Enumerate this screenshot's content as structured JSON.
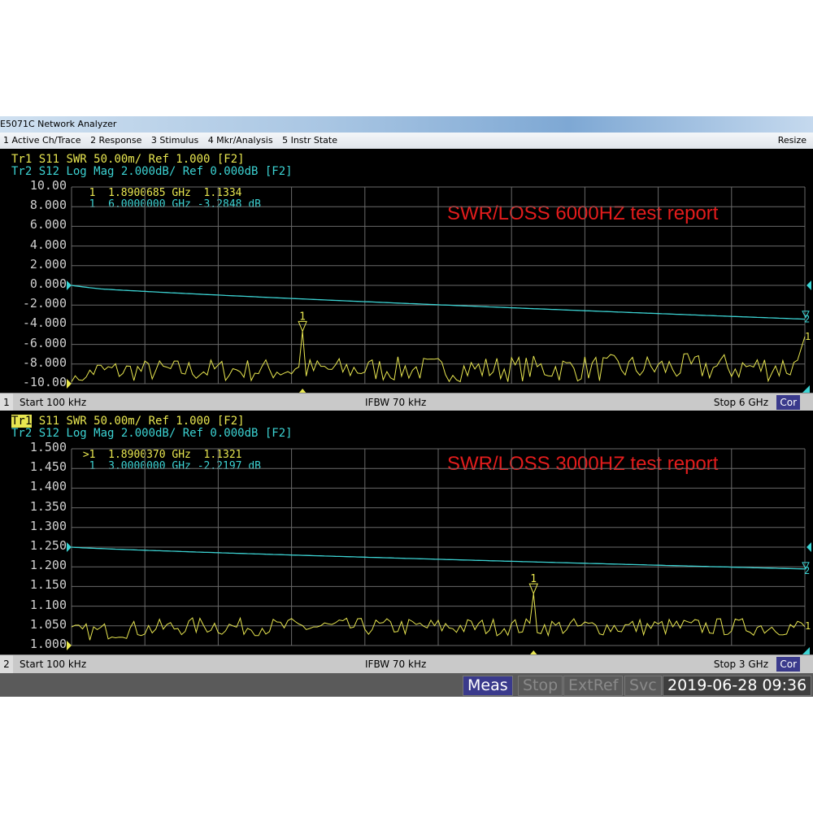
{
  "window": {
    "title": "E5071C Network Analyzer",
    "resize_label": "Resize"
  },
  "menu": [
    "1 Active Ch/Trace",
    "2 Response",
    "3 Stimulus",
    "4 Mkr/Analysis",
    "5 Instr State"
  ],
  "colors": {
    "trace1": "#e8e650",
    "trace2": "#3cd3d3",
    "annotation": "#e31c1c",
    "grid": "#6a6a6a"
  },
  "channels": [
    {
      "tr1_header": "Tr1 S11 SWR 50.00m/ Ref 1.000 [F2]",
      "tr2_header": "Tr2 S12 Log Mag 2.000dB/ Ref 0.000dB [F2]",
      "marker1": "  1  1.8900685 GHz  1.1334",
      "marker2": "  1  6.0000000 GHz -3.2848 dB",
      "annotation": "SWR/LOSS 6000HZ test report",
      "yticks": [
        "10.00",
        "8.000",
        "6.000",
        "4.000",
        "2.000",
        "0.000",
        "-2.000",
        "-4.000",
        "-6.000",
        "-8.000",
        "-10.00"
      ],
      "channel_number": "1",
      "start": "Start 100 kHz",
      "ifbw": "IFBW 70 kHz",
      "stop": "Stop 6 GHz",
      "cor": "Cor",
      "chart_data": {
        "type": "line",
        "x_range_ghz": [
          0.0001,
          6
        ],
        "tr1": {
          "name": "S11 SWR",
          "scale_per_div": 0.05,
          "ref": 1.0,
          "marker_x_ghz": 1.8900685,
          "marker_y": 1.1334
        },
        "tr2": {
          "name": "S12 Log Mag",
          "scale_db_per_div": 2,
          "ref_db": 0,
          "start_db": 0,
          "end_db": -3.2848
        }
      },
      "marker_label": "1",
      "trace2_label": "2"
    },
    {
      "tr1_header": "Tr1 S11 SWR 50.00m/ Ref 1.000 [F2]",
      "tr2_header": "Tr2 S12 Log Mag 2.000dB/ Ref 0.000dB [F2]",
      "marker1": " >1  1.8900370 GHz  1.1321",
      "marker2": "  1  3.0000000 GHz -2.2197 dB",
      "annotation": "SWR/LOSS 3000HZ test report",
      "yticks": [
        "1.500",
        "1.450",
        "1.400",
        "1.350",
        "1.300",
        "1.250",
        "1.200",
        "1.150",
        "1.100",
        "1.050",
        "1.000"
      ],
      "channel_number": "2",
      "start": "Start 100 kHz",
      "ifbw": "IFBW 70 kHz",
      "stop": "Stop 3 GHz",
      "cor": "Cor",
      "chart_data": {
        "type": "line",
        "x_range_ghz": [
          0.0001,
          3
        ],
        "tr1": {
          "name": "S11 SWR",
          "scale_per_div": 0.05,
          "ref": 1.0,
          "marker_x_ghz": 1.890037,
          "marker_y": 1.1321
        },
        "tr2": {
          "name": "S12 Log Mag",
          "scale_db_per_div": 2,
          "ref_db": 0,
          "start_db": 0,
          "end_db": -2.2197
        }
      },
      "marker_label": "1",
      "trace2_label": "2"
    }
  ],
  "status": {
    "meas": "Meas",
    "stop": "Stop",
    "extref": "ExtRef",
    "svc": "Svc",
    "datetime": "2019-06-28 09:36"
  }
}
